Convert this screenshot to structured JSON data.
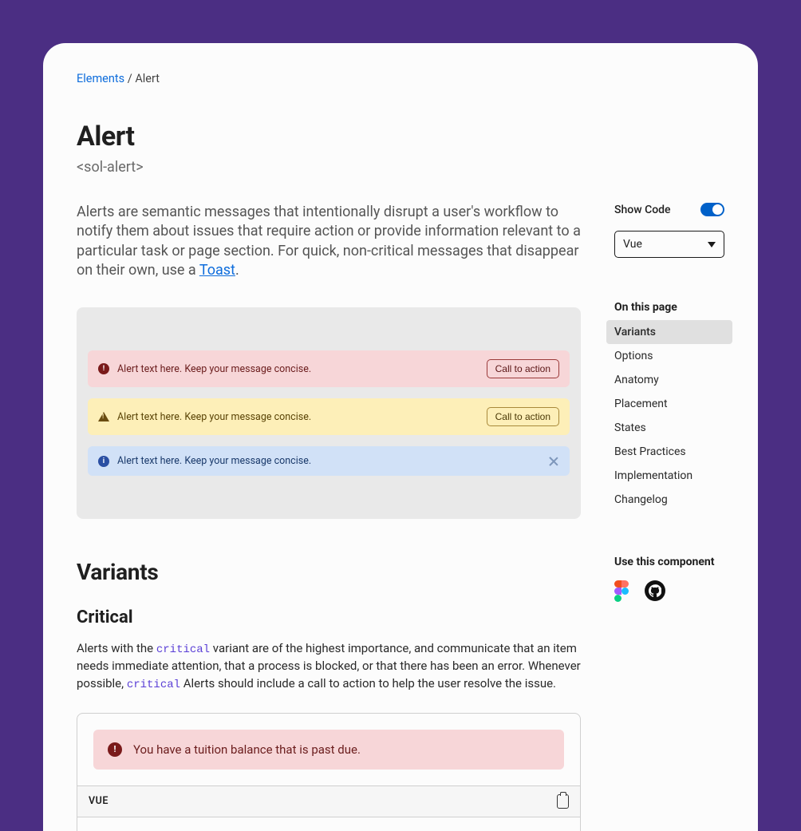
{
  "breadcrumb": {
    "root": "Elements",
    "sep": "/",
    "current": "Alert"
  },
  "page": {
    "title": "Alert",
    "tag": "<sol-alert>",
    "lead_pre": "Alerts are semantic messages that intentionally disrupt a user's workflow to notify them about issues that require action or provide information relevant to a particular task or page section. For quick, non-critical messages that disappear on their own, use a ",
    "lead_link": "Toast",
    "lead_post": "."
  },
  "demo": {
    "msg": "Alert text here. Keep your message concise.",
    "cta": "Call to action"
  },
  "variants": {
    "heading": "Variants",
    "critical_h": "Critical",
    "critical_p1": "Alerts with the ",
    "critical_code1": "critical",
    "critical_p2": " variant are of the highest importance, and communicate that an item needs immediate attention, that a process is blocked, or that there has been an error. Whenever possible, ",
    "critical_code2": "critical",
    "critical_p3": " Alerts should include a call to action to help the user resolve the issue.",
    "example_msg": "You have a tuition balance that is past due.",
    "code_label": "VUE"
  },
  "side": {
    "show_code": "Show Code",
    "framework": "Vue",
    "otp_title": "On this page",
    "otp": [
      "Variants",
      "Options",
      "Anatomy",
      "Placement",
      "States",
      "Best Practices",
      "Implementation",
      "Changelog"
    ],
    "use_title": "Use this component"
  }
}
